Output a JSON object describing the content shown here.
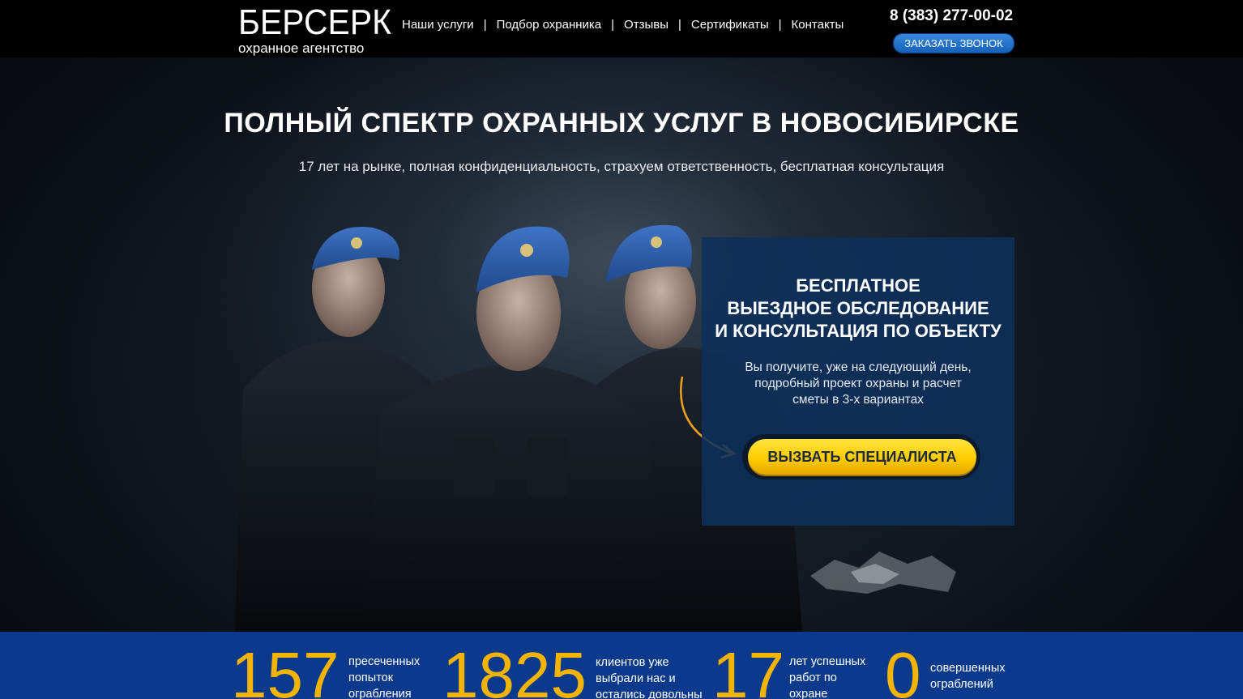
{
  "header": {
    "logo_name": "БЕРСЕРК",
    "logo_sub": "охранное агентство",
    "nav": [
      {
        "label": "Наши услуги"
      },
      {
        "label": "Подбор охранника"
      },
      {
        "label": "Отзывы"
      },
      {
        "label": "Сертификаты"
      },
      {
        "label": "Контакты"
      }
    ],
    "nav_separator": "|",
    "phone": "8 (383) 277-00-02",
    "callback_label": "ЗАКАЗАТЬ ЗВОНОК"
  },
  "hero": {
    "title": "ПОЛНЫЙ СПЕКТР ОХРАННЫХ УСЛУГ В НОВОСИБИРСКЕ",
    "subtitle": "17 лет на рынке, полная конфиденциальность, страхуем ответственность, бесплатная консультация"
  },
  "offer": {
    "title_lines": [
      "БЕСПЛАТНОЕ",
      "ВЫЕЗДНОЕ ОБСЛЕДОВАНИЕ",
      "И КОНСУЛЬТАЦИЯ ПО ОБЪЕКТУ"
    ],
    "text_lines": [
      "Вы получите, уже на следующий день,",
      "подробный проект охраны и расчет",
      "сметы в 3-х вариантах"
    ],
    "cta_label": "ВЫЗВАТЬ СПЕЦИАЛИСТА"
  },
  "stats": [
    {
      "value": "157",
      "label_lines": [
        "пресеченных",
        "попыток",
        "ограбления"
      ]
    },
    {
      "value": "1825",
      "label_lines": [
        "клиентов уже",
        "выбрали нас и",
        "остались довольны"
      ]
    },
    {
      "value": "17",
      "label_lines": [
        "лет успешных",
        "работ по",
        "охране"
      ]
    },
    {
      "value": "0",
      "label_lines": [
        "совершенных",
        "ограблений"
      ]
    }
  ],
  "colors": {
    "header_bg": "#000000",
    "accent_blue": "#145fb8",
    "panel_blue": "#0e305c",
    "cta_yellow": "#ffcc00",
    "stats_bg": "#0b3a8c",
    "stat_number": "#f3b400"
  }
}
